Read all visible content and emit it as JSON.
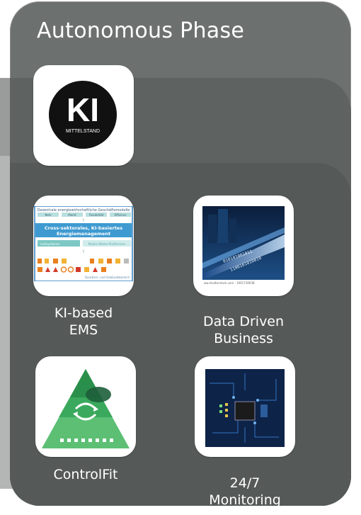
{
  "panel": {
    "title": "Autonomous Phase"
  },
  "logo": {
    "letters": "KI",
    "subtitle": "MITTELSTAND"
  },
  "tiles": [
    {
      "label_line1": "KI-based",
      "label_line2": "EMS"
    },
    {
      "label_line1": "Data Driven",
      "label_line2": "Business"
    },
    {
      "label_line1": "ControlFit",
      "label_line2": ""
    },
    {
      "label_line1": "24/7",
      "label_line2": "Monitoring"
    }
  ],
  "ems_image": {
    "header": "Dezentrale energiewirtschaftliche Geschäftsmodelle",
    "tags": [
      "Netz",
      "Markt",
      "Flexibilität",
      "Effizienz"
    ],
    "band_line1": "Cross-sektorales, KI-basiertes",
    "band_line2": "Energiemanagement",
    "left_box": "Leitsysteme",
    "right_box": "Mobile Wetter-Plattformen",
    "footer": "Quartiers- und Gebäudebereich"
  },
  "data_image": {
    "caption": "ww.shutterstock.com · 1091736938"
  },
  "colors": {
    "panel": "#6c716f",
    "ems_blue": "#3e9ad0",
    "ems_teal": "#7dc8c4",
    "pyramid_green": "#3aa95d"
  }
}
